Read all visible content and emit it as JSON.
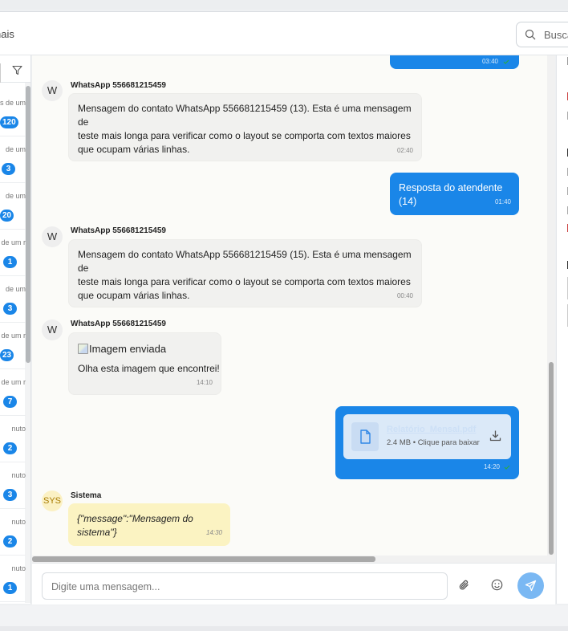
{
  "header": {
    "channels_label": "nais",
    "search_placeholder": "Buscar"
  },
  "conversations": [
    {
      "snippet": "s de um",
      "badge": "120"
    },
    {
      "snippet": "de um",
      "badge": "3"
    },
    {
      "snippet": "de um",
      "badge": "20"
    },
    {
      "snippet": "de um r",
      "badge": "1"
    },
    {
      "snippet": "de um",
      "badge": "3"
    },
    {
      "snippet": "de um r",
      "badge": "23"
    },
    {
      "snippet": "de um r",
      "badge": "7"
    },
    {
      "snippet": "nuto",
      "badge": "2"
    },
    {
      "snippet": "nuto",
      "badge": "3"
    },
    {
      "snippet": "nuto",
      "badge": "2"
    },
    {
      "snippet": "nuto",
      "badge": "1"
    }
  ],
  "messages": {
    "top_out_time": "03:40",
    "m1": {
      "avatar": "W",
      "sender": "WhatsApp 556681215459",
      "lines": [
        "Mensagem do contato WhatsApp 556681215459 (13). Esta é uma mensagem de",
        "teste mais longa para verificar como o layout se comporta com textos maiores",
        "que ocupam várias linhas."
      ],
      "time": "02:40"
    },
    "m2": {
      "text": "Resposta do atendente (14)",
      "time": "01:40"
    },
    "m3": {
      "avatar": "W",
      "sender": "WhatsApp 556681215459",
      "lines": [
        "Mensagem do contato WhatsApp 556681215459 (15). Esta é uma mensagem de",
        "teste mais longa para verificar como o layout se comporta com textos maiores",
        "que ocupam várias linhas."
      ],
      "time": "00:40"
    },
    "m4": {
      "avatar": "W",
      "sender": "WhatsApp 556681215459",
      "image_alt": "Imagem enviada",
      "caption": "Olha esta imagem que encontrei!",
      "time": "14:10"
    },
    "m5": {
      "file_name": "Relatório_Mensal.pdf",
      "file_meta": "2.4 MB • Clique para baixar",
      "time": "14:20"
    },
    "m6": {
      "avatar": "SYS",
      "sender": "Sistema",
      "text": "{\"message\":\"Mensagem do sistema\"}",
      "time": "14:30"
    }
  },
  "composer": {
    "placeholder": "Digite uma mensagem..."
  },
  "colors": {
    "accent": "#1a86e8",
    "system_bubble": "#fbf3c2",
    "incoming_bubble": "#f1f1ef"
  }
}
